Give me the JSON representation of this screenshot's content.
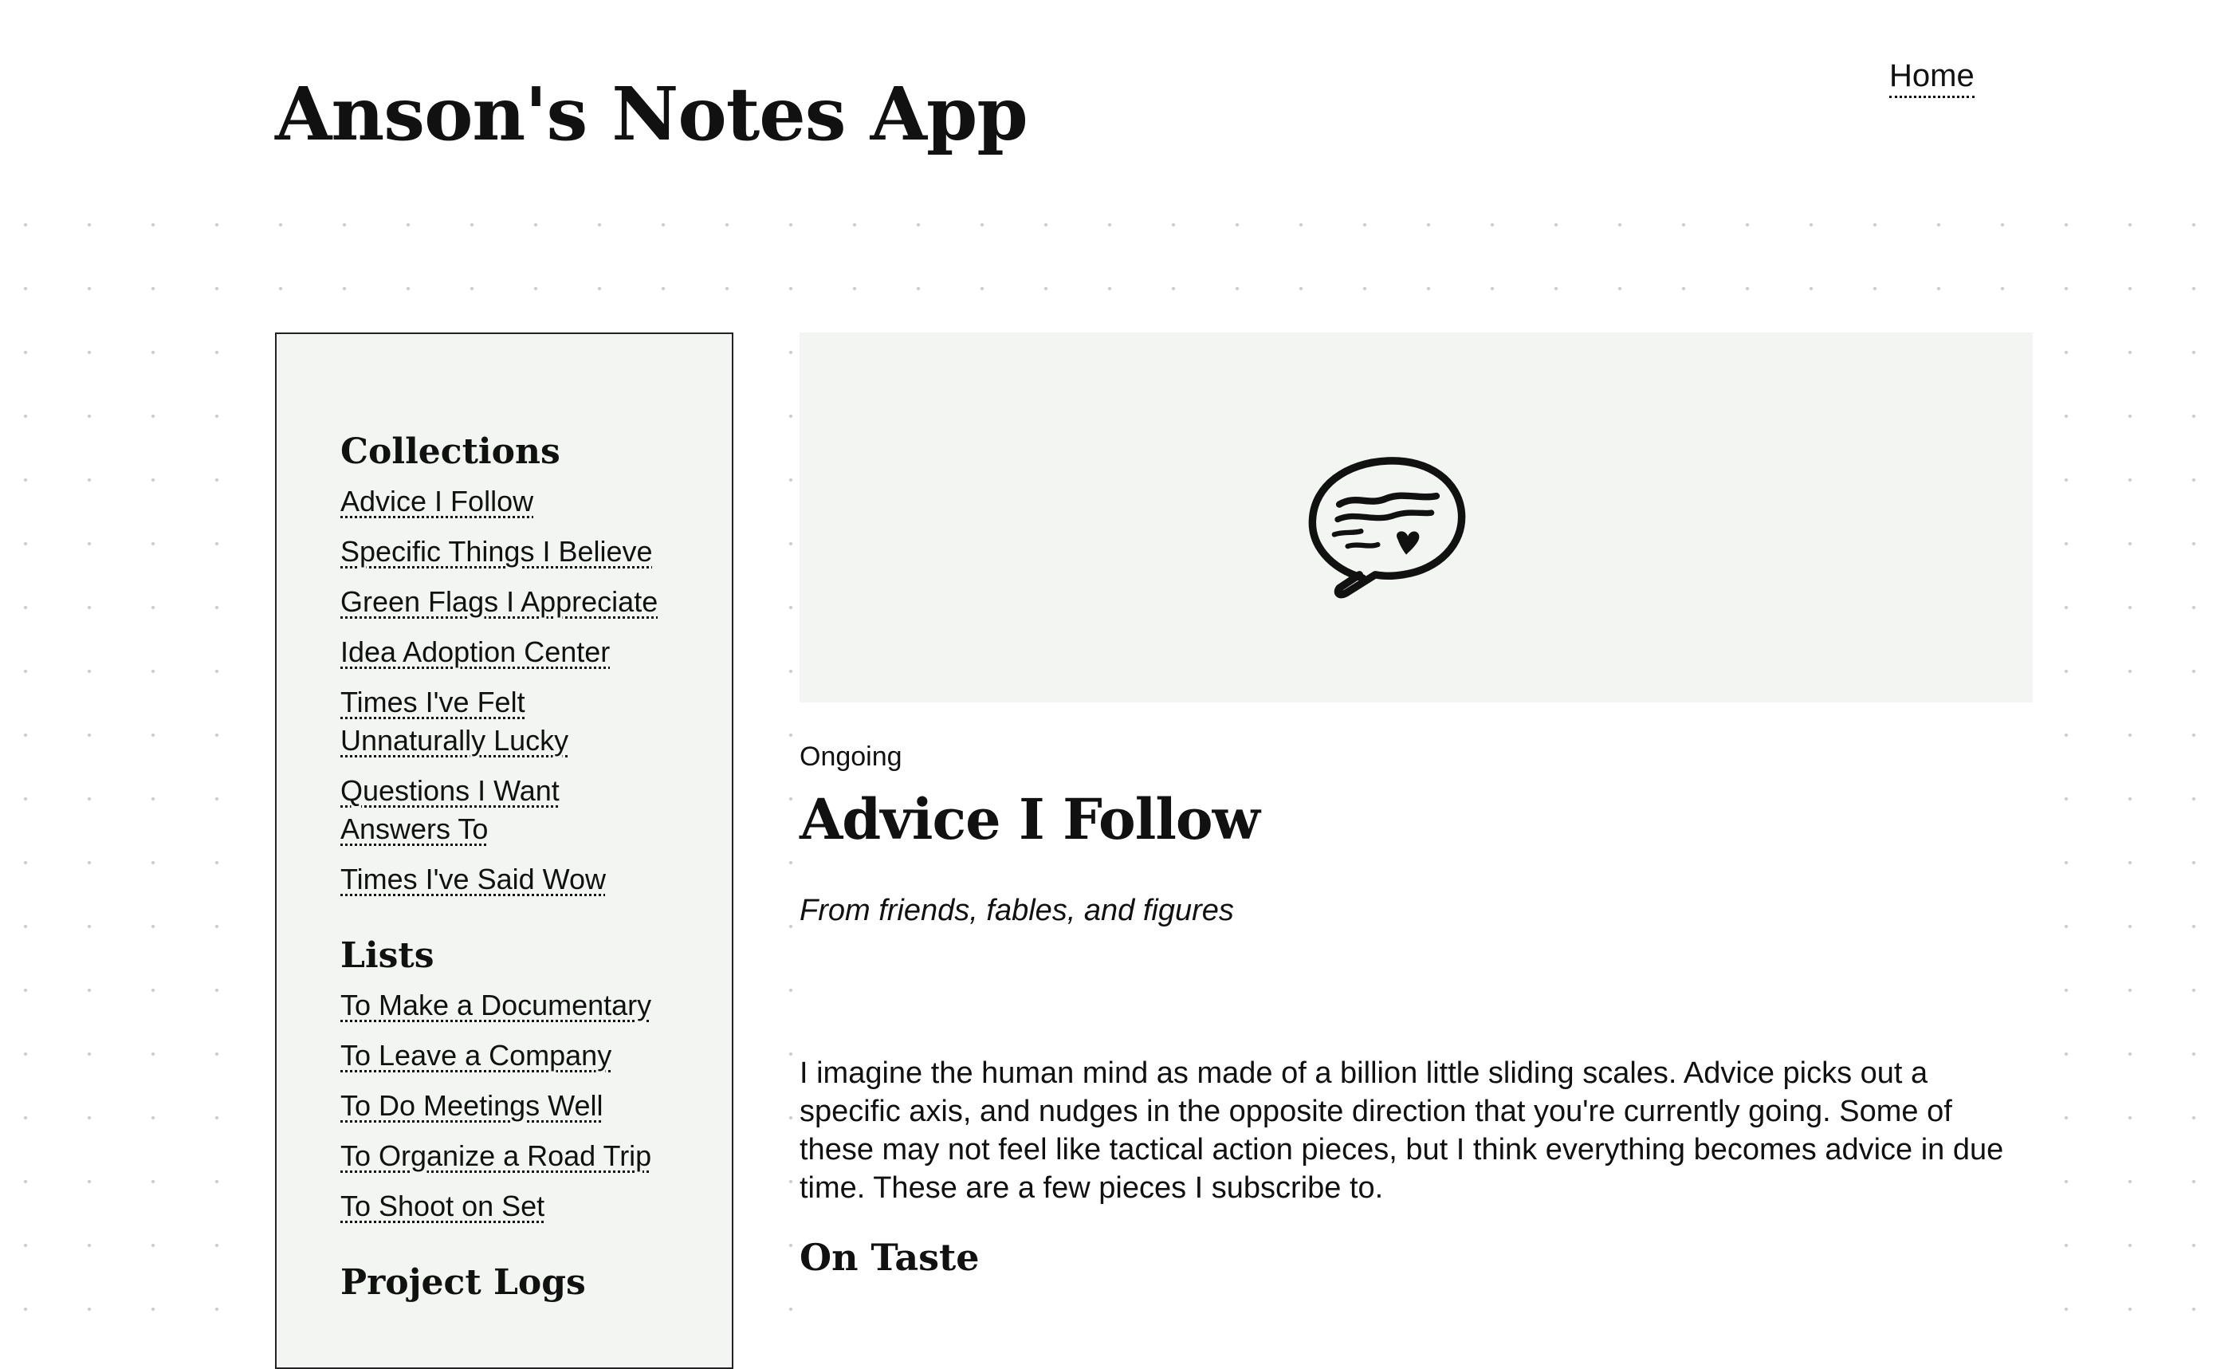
{
  "app": {
    "title": "Anson's Notes App"
  },
  "nav": {
    "home_label": "Home"
  },
  "sidebar": {
    "sections": [
      {
        "heading": "Collections",
        "items": [
          "Advice I Follow",
          "Specific Things I Believe",
          "Green Flags I Appreciate",
          "Idea Adoption Center",
          "Times I've Felt Unnaturally Lucky",
          "Questions I Want Answers To",
          "Times I've Said Wow"
        ]
      },
      {
        "heading": "Lists",
        "items": [
          "To Make a Documentary",
          "To Leave a Company",
          "To Do Meetings Well",
          "To Organize a Road Trip",
          "To Shoot on Set"
        ]
      },
      {
        "heading": "Project Logs",
        "items": []
      }
    ]
  },
  "main": {
    "hero_icon": "speech-bubble-heart-icon",
    "status": "Ongoing",
    "title": "Advice I Follow",
    "subtitle": "From friends, fables, and figures",
    "intro": "I imagine the human mind as made of a billion little sliding scales. Advice picks out a specific axis, and nudges in the opposite direction that you're currently going. Some of these may not feel like tactical action pieces, but I think everything becomes advice in due time. These are a few pieces I subscribe to.",
    "section_heading": "On Taste"
  }
}
